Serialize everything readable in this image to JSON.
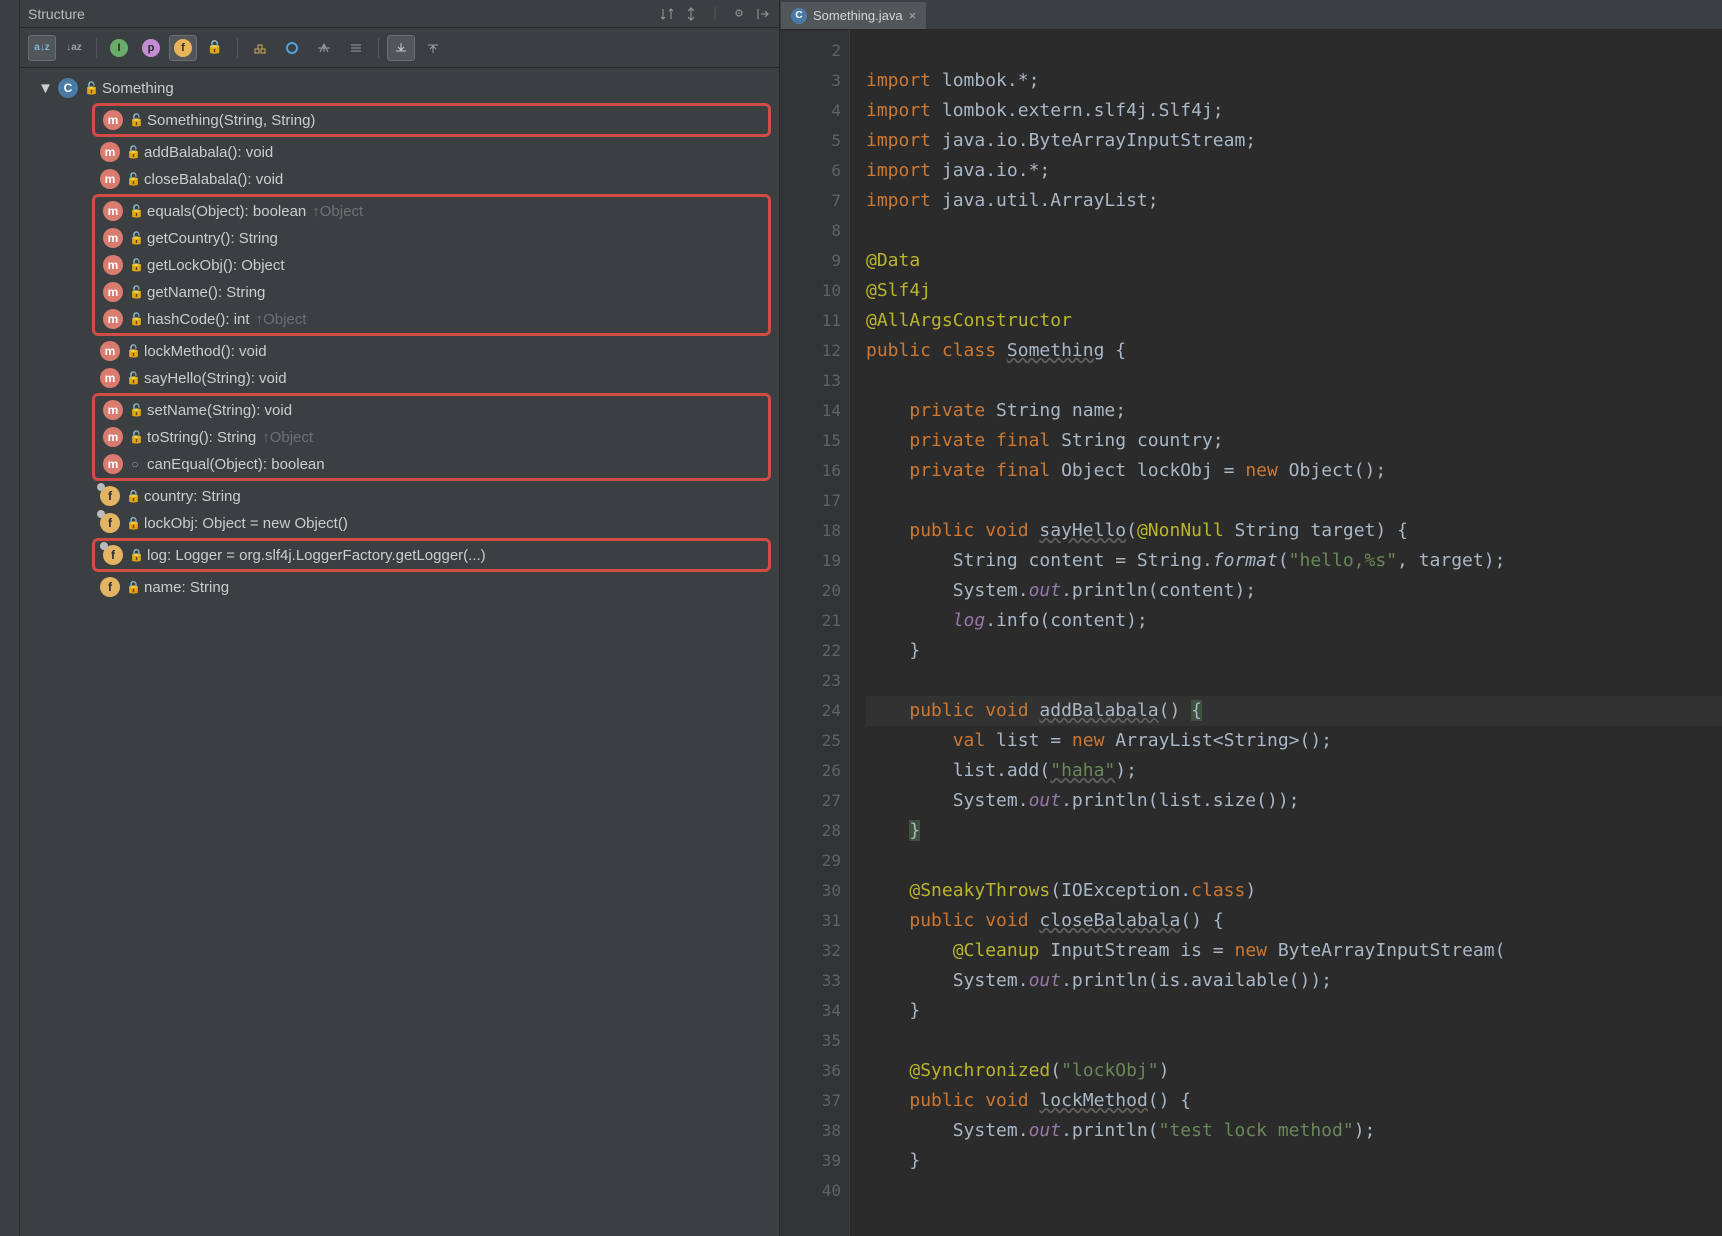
{
  "structure": {
    "title": "Structure",
    "sorts": {
      "az_label": "a↓z",
      "za_label": "↓az"
    },
    "class": "Something",
    "items": [
      {
        "kind": "m",
        "mod": "open",
        "label": "Something(String, String)",
        "box": 1
      },
      {
        "kind": "m",
        "mod": "open",
        "label": "addBalabala(): void"
      },
      {
        "kind": "m",
        "mod": "open",
        "label": "closeBalabala(): void"
      },
      {
        "kind": "m",
        "mod": "open",
        "label": "equals(Object): boolean",
        "super": "Object",
        "box": 2
      },
      {
        "kind": "m",
        "mod": "open",
        "label": "getCountry(): String",
        "box": 2
      },
      {
        "kind": "m",
        "mod": "open",
        "label": "getLockObj(): Object",
        "box": 2
      },
      {
        "kind": "m",
        "mod": "open",
        "label": "getName(): String",
        "box": 2
      },
      {
        "kind": "m",
        "mod": "open",
        "label": "hashCode(): int",
        "super": "Object",
        "box": 2
      },
      {
        "kind": "m",
        "mod": "open",
        "label": "lockMethod(): void"
      },
      {
        "kind": "m",
        "mod": "open",
        "label": "sayHello(String): void"
      },
      {
        "kind": "m",
        "mod": "open",
        "label": "setName(String): void",
        "box": 3
      },
      {
        "kind": "m",
        "mod": "open",
        "label": "toString(): String",
        "super": "Object",
        "box": 3
      },
      {
        "kind": "m",
        "mod": "key",
        "label": "canEqual(Object): boolean",
        "box": 3
      },
      {
        "kind": "f",
        "mod": "lock",
        "final": true,
        "label": "country: String"
      },
      {
        "kind": "f",
        "mod": "lock",
        "final": true,
        "label": "lockObj: Object = new Object()"
      },
      {
        "kind": "f",
        "mod": "lock",
        "final": true,
        "label": "log: Logger = org.slf4j.LoggerFactory.getLogger(...)",
        "box": 4
      },
      {
        "kind": "f",
        "mod": "lock",
        "label": "name: String"
      }
    ]
  },
  "editor": {
    "tab_label": "Something.java",
    "lines": [
      {
        "n": 2,
        "html": ""
      },
      {
        "n": 3,
        "html": "<span class='kw'>import</span> lombok.*;"
      },
      {
        "n": 4,
        "html": "<span class='kw'>import</span> lombok.extern.slf4j.Slf4j;"
      },
      {
        "n": 5,
        "html": "<span class='kw'>import</span> java.io.ByteArrayInputStream;"
      },
      {
        "n": 6,
        "html": "<span class='kw'>import</span> java.io.*;"
      },
      {
        "n": 7,
        "html": "<span class='kw'>import</span> java.util.ArrayList;"
      },
      {
        "n": 8,
        "html": ""
      },
      {
        "n": 9,
        "html": "<span class='ann'>@Data</span>"
      },
      {
        "n": 10,
        "html": "<span class='ann'>@Slf4j</span>"
      },
      {
        "n": 11,
        "html": "<span class='ann'>@AllArgsConstructor</span>"
      },
      {
        "n": 12,
        "html": "<span class='kw'>public class</span> <span class='squig'>Something</span> {"
      },
      {
        "n": 13,
        "html": ""
      },
      {
        "n": 14,
        "html": "    <span class='kw'>private</span> String name;"
      },
      {
        "n": 15,
        "html": "    <span class='kw'>private final</span> String country;"
      },
      {
        "n": 16,
        "html": "    <span class='kw'>private final</span> Object lockObj = <span class='kw'>new</span> Object();"
      },
      {
        "n": 17,
        "html": ""
      },
      {
        "n": 18,
        "html": "    <span class='kw'>public void</span> <span class='squig'>sayHello</span>(<span class='ann'>@NonNull</span> String target) {"
      },
      {
        "n": 19,
        "html": "        String content = String.<span class='it'>format</span>(<span class='str'>\"hello,%s\"</span>, target);"
      },
      {
        "n": 20,
        "html": "        System.<span class='st'>out</span>.println(content);"
      },
      {
        "n": 21,
        "html": "        <span class='it st'>log</span>.info(content);"
      },
      {
        "n": 22,
        "html": "    }"
      },
      {
        "n": 23,
        "html": ""
      },
      {
        "n": 24,
        "html": "    <span class='kw'>public void</span> <span class='squig'>addBalabala</span>() <span class='brace-hl'>{</span>",
        "cur": true
      },
      {
        "n": 25,
        "html": "        <span class='kw'>val</span> list = <span class='kw'>new</span> ArrayList&lt;String&gt;();"
      },
      {
        "n": 26,
        "html": "        list.add(<span class='str squig'>\"haha\"</span>);"
      },
      {
        "n": 27,
        "html": "        System.<span class='st'>out</span>.println(list.size());"
      },
      {
        "n": 28,
        "html": "    <span class='brace-hl'>}</span>"
      },
      {
        "n": 29,
        "html": ""
      },
      {
        "n": 30,
        "html": "    <span class='ann'>@SneakyThrows</span>(IOException.<span class='kw'>class</span>)"
      },
      {
        "n": 31,
        "html": "    <span class='kw'>public void</span> <span class='squig'>closeBalabala</span>() {"
      },
      {
        "n": 32,
        "html": "        <span class='ann'>@Cleanup</span> InputStream is = <span class='kw'>new</span> ByteArrayInputStream("
      },
      {
        "n": 33,
        "html": "        System.<span class='st'>out</span>.println(is.available());"
      },
      {
        "n": 34,
        "html": "    }"
      },
      {
        "n": 35,
        "html": ""
      },
      {
        "n": 36,
        "html": "    <span class='ann'>@Synchronized</span>(<span class='str'>\"lockObj\"</span>)"
      },
      {
        "n": 37,
        "html": "    <span class='kw'>public void</span> <span class='squig'>lockMethod</span>() {"
      },
      {
        "n": 38,
        "html": "        System.<span class='st'>out</span>.println(<span class='str'>\"test lock method\"</span>);"
      },
      {
        "n": 39,
        "html": "    }"
      },
      {
        "n": 40,
        "html": ""
      }
    ]
  }
}
